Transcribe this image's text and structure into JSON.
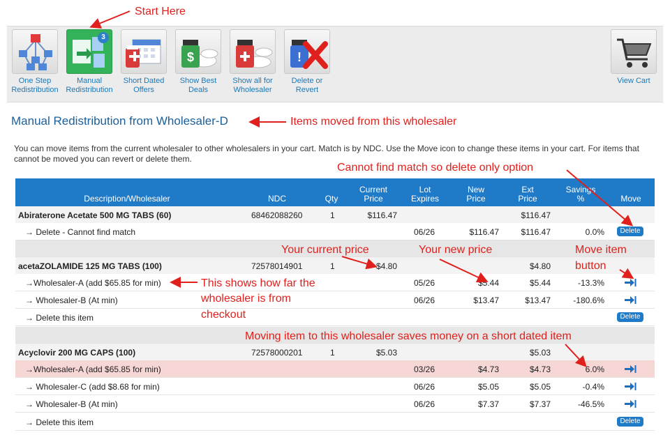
{
  "annotations": {
    "start": "Start Here",
    "moved_from": "Items moved from this wholesaler",
    "cannot_find": "Cannot find match so delete only option",
    "current_price": "Your current price",
    "new_price": "Your new price",
    "move_button": [
      "Move item",
      "button"
    ],
    "how_far": [
      "This shows how far the",
      "wholesaler is from",
      "checkout"
    ],
    "saves": "Moving item to this wholesaler saves money on a short dated item"
  },
  "toolbar": {
    "items": [
      {
        "label": [
          "One Step",
          "Redistribution"
        ],
        "icon": "network-icon"
      },
      {
        "label": [
          "Manual",
          "Redistribution"
        ],
        "icon": "redistribute-icon",
        "badge": "3"
      },
      {
        "label": [
          "Short Dated",
          "Offers"
        ],
        "icon": "calendar-icon"
      },
      {
        "label": [
          "Show Best",
          "Deals"
        ],
        "icon": "dollar-bottle-icon"
      },
      {
        "label": [
          "Show all for",
          "Wholesaler"
        ],
        "icon": "pills-icon"
      },
      {
        "label": [
          "Delete or",
          "Revert"
        ],
        "icon": "delete-x-icon"
      }
    ],
    "cart": {
      "label": "View Cart",
      "icon": "shopping-cart-icon"
    }
  },
  "page": {
    "title": "Manual Redistribution from Wholesaler-D",
    "intro": "You can move items from the current wholesaler to other wholesalers in your cart. Match is by NDC. Use the Move icon to change these items in your cart. For items that cannot be moved you can revert or delete them."
  },
  "table": {
    "headers": {
      "desc": "Description/Wholesaler",
      "ndc": "NDC",
      "qty": "Qty",
      "current_price": [
        "Current",
        "Price"
      ],
      "lot_expires": [
        "Lot",
        "Expires"
      ],
      "new_price": [
        "New",
        "Price"
      ],
      "ext_price": [
        "Ext",
        "Price"
      ],
      "savings": [
        "Savings",
        "%"
      ],
      "move": "Move"
    },
    "delete_label": "Delete",
    "rows": [
      {
        "type": "product",
        "desc": "Abiraterone Acetate 500 MG TABS (60)",
        "ndc": "68462088260",
        "qty": "1",
        "current": "$116.47",
        "ext": "$116.47"
      },
      {
        "type": "option",
        "desc": "→ Delete - Cannot find match",
        "lot": "06/26",
        "new": "$116.47",
        "ext": "$116.47",
        "savings": "0.0%",
        "action": "delete"
      },
      {
        "type": "spacer"
      },
      {
        "type": "product",
        "desc": "acetaZOLAMIDE 125 MG TABS (100)",
        "ndc": "72578014901",
        "qty": "1",
        "current": "$4.80",
        "ext": "$4.80"
      },
      {
        "type": "option",
        "desc": "→Wholesaler-A  (add $65.85 for min)",
        "lot": "05/26",
        "new": "$5.44",
        "ext": "$5.44",
        "savings": "-13.3%",
        "action": "move"
      },
      {
        "type": "option",
        "desc": "→ Wholesaler-B  (At min)",
        "lot": "06/26",
        "new": "$13.47",
        "ext": "$13.47",
        "savings": "-180.6%",
        "action": "move"
      },
      {
        "type": "option",
        "desc": "→ Delete this item",
        "action": "delete"
      },
      {
        "type": "spacer"
      },
      {
        "type": "product",
        "desc": "Acyclovir 200 MG CAPS (100)",
        "ndc": "72578000201",
        "qty": "1",
        "current": "$5.03",
        "ext": "$5.03"
      },
      {
        "type": "option",
        "highlight": true,
        "desc": "→Wholesaler-A  (add $65.85 for min)",
        "lot": "03/26",
        "new": "$4.73",
        "ext": "$4.73",
        "savings": "6.0%",
        "action": "move"
      },
      {
        "type": "option",
        "desc": "→ Wholesaler-C  (add $8.68 for min)",
        "lot": "06/26",
        "new": "$5.05",
        "ext": "$5.05",
        "savings": "-0.4%",
        "action": "move"
      },
      {
        "type": "option",
        "desc": "→ Wholesaler-B  (At min)",
        "lot": "06/26",
        "new": "$7.37",
        "ext": "$7.37",
        "savings": "-46.5%",
        "action": "move"
      },
      {
        "type": "option",
        "desc": "→ Delete this item",
        "action": "delete"
      }
    ]
  },
  "colors": {
    "accent": "#1f7ac7",
    "annotation": "#e0201c",
    "highlight_row": "#f7d6d6",
    "active_tile": "#33b25a"
  }
}
